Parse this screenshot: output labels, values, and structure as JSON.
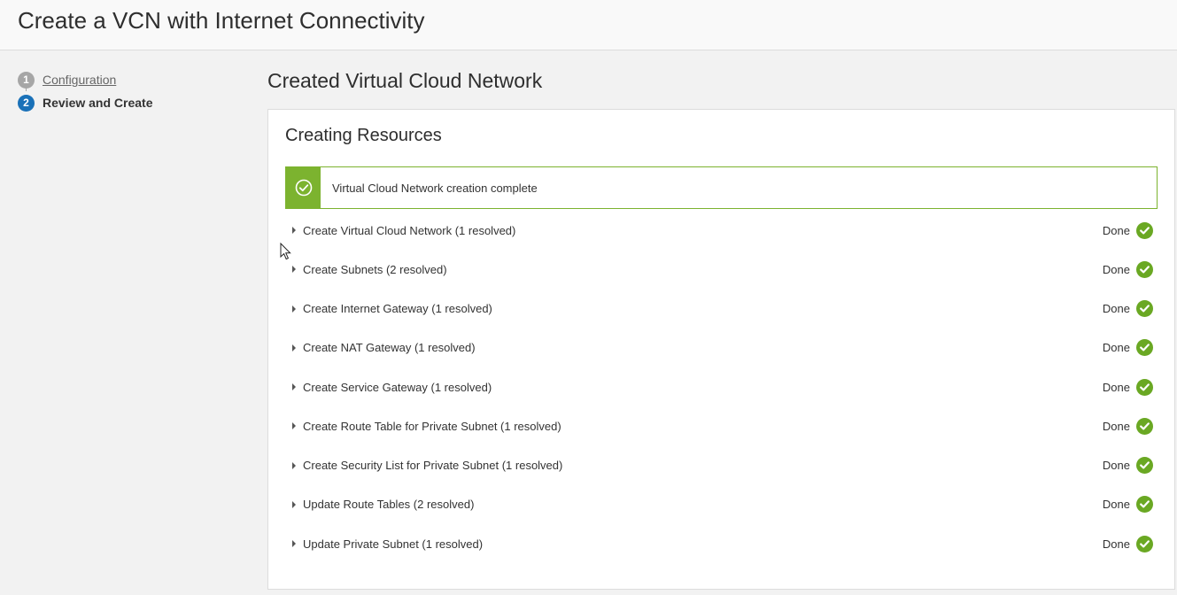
{
  "header": {
    "title": "Create a VCN with Internet Connectivity"
  },
  "wizard": {
    "steps": [
      {
        "number": "1",
        "label": "Configuration",
        "state": "completed"
      },
      {
        "number": "2",
        "label": "Review and Create",
        "state": "current"
      }
    ]
  },
  "main": {
    "title": "Created Virtual Cloud Network",
    "card_title": "Creating Resources",
    "banner": {
      "message": "Virtual Cloud Network creation complete",
      "color": "#7cb32f"
    },
    "tasks": [
      {
        "label": "Create Virtual Cloud Network (1 resolved)",
        "status": "Done"
      },
      {
        "label": "Create Subnets (2 resolved)",
        "status": "Done"
      },
      {
        "label": "Create Internet Gateway (1 resolved)",
        "status": "Done"
      },
      {
        "label": "Create NAT Gateway (1 resolved)",
        "status": "Done"
      },
      {
        "label": "Create Service Gateway (1 resolved)",
        "status": "Done"
      },
      {
        "label": "Create Route Table for Private Subnet (1 resolved)",
        "status": "Done"
      },
      {
        "label": "Create Security List for Private Subnet (1 resolved)",
        "status": "Done"
      },
      {
        "label": "Update Route Tables (2 resolved)",
        "status": "Done"
      },
      {
        "label": "Update Private Subnet (1 resolved)",
        "status": "Done"
      }
    ],
    "status_color": "#6aa823"
  }
}
